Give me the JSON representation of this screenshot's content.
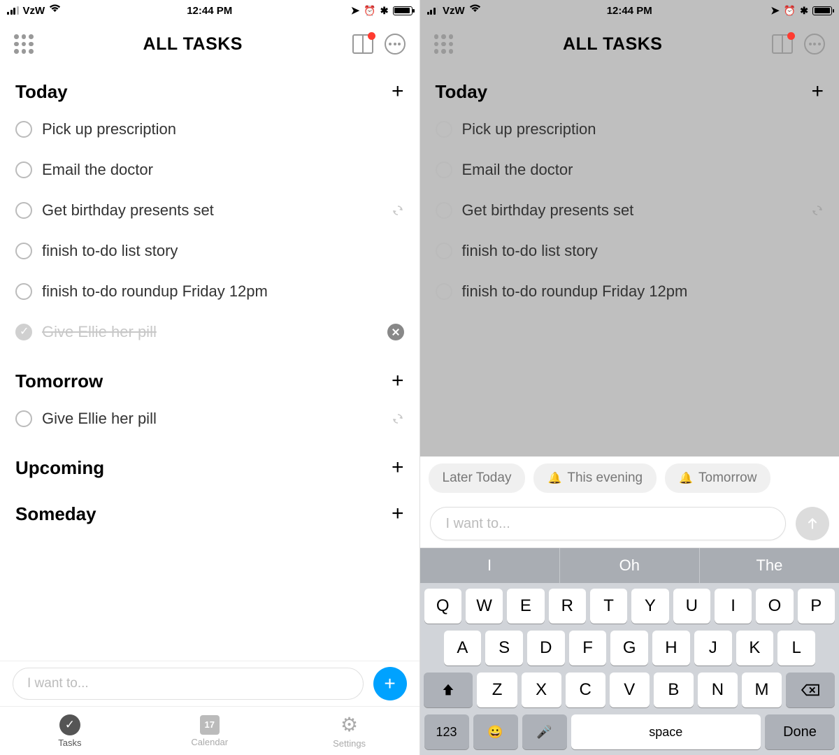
{
  "status": {
    "carrier": "VzW",
    "time": "12:44 PM"
  },
  "header": {
    "title": "ALL TASKS"
  },
  "left": {
    "sections": {
      "today": {
        "title": "Today"
      },
      "tomorrow": {
        "title": "Tomorrow"
      },
      "upcoming": {
        "title": "Upcoming"
      },
      "someday": {
        "title": "Someday"
      }
    },
    "todayTasks": [
      "Pick up prescription",
      "Email the doctor",
      "Get birthday presents set",
      "finish to-do list story",
      "finish to-do roundup Friday 12pm"
    ],
    "completedTask": "Give Ellie her pill",
    "tomorrowTask": "Give Ellie her pill",
    "inputPlaceholder": "I want to...",
    "tabs": {
      "tasks": "Tasks",
      "calendar": "Calendar",
      "calDay": "17",
      "settings": "Settings"
    }
  },
  "right": {
    "todayTasks": [
      "Pick up prescription",
      "Email the doctor",
      "Get birthday presents set",
      "finish to-do list story",
      "finish to-do roundup Friday 12pm"
    ],
    "chips": {
      "later": "Later Today",
      "evening": "This evening",
      "tomorrow": "Tomorrow"
    },
    "inputPlaceholder": "I want to...",
    "kbSuggest": [
      "I",
      "Oh",
      "The"
    ],
    "kbRows": {
      "r1": [
        "Q",
        "W",
        "E",
        "R",
        "T",
        "Y",
        "U",
        "I",
        "O",
        "P"
      ],
      "r2": [
        "A",
        "S",
        "D",
        "F",
        "G",
        "H",
        "J",
        "K",
        "L"
      ],
      "r3": [
        "Z",
        "X",
        "C",
        "V",
        "B",
        "N",
        "M"
      ]
    },
    "kbBottom": {
      "num": "123",
      "space": "space",
      "done": "Done"
    }
  }
}
